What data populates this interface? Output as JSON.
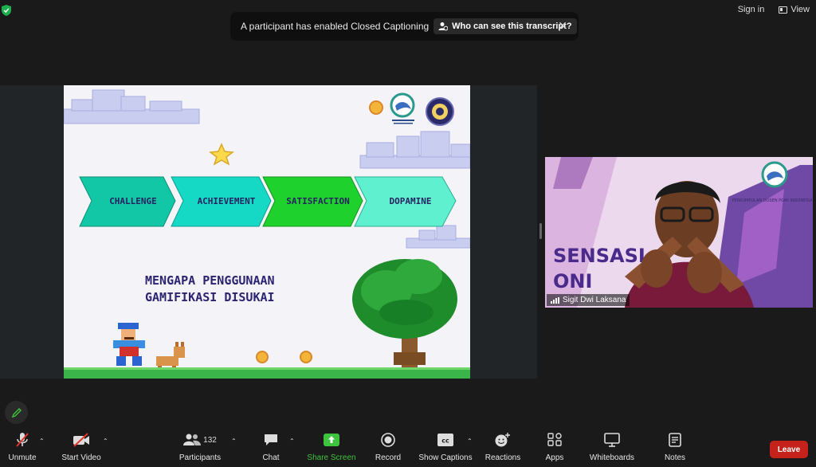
{
  "top": {
    "sign_in": "Sign in",
    "view": "View"
  },
  "notification": {
    "message": "A participant has enabled Closed Captioning",
    "button": "Who can see this transcript?"
  },
  "slide": {
    "steps": [
      "CHALLENGE",
      "ACHIEVEMENT",
      "SATISFACTION",
      "DOPAMINE"
    ],
    "title_line1": "MENGAPA PENGGUNAAN",
    "title_line2": "GAMIFIKASI DISUKAI",
    "colors": {
      "step1": "#12c7a6",
      "step2": "#16d9c5",
      "step3": "#1fd12c",
      "step4": "#5ff0d0",
      "title": "#2b2470"
    }
  },
  "video": {
    "speaker_name": "Sigit Dwi Laksana",
    "banner_text": "SENSASI",
    "banner_text2": "ONI",
    "org_text": "PERKUMPULAN DOSEN PGMI INDONESIA"
  },
  "toolbar": {
    "unmute": "Unmute",
    "start_video": "Start Video",
    "participants": "Participants",
    "participants_count": "132",
    "chat": "Chat",
    "share_screen": "Share Screen",
    "record": "Record",
    "show_captions": "Show Captions",
    "reactions": "Reactions",
    "apps": "Apps",
    "whiteboards": "Whiteboards",
    "notes": "Notes",
    "leave": "Leave"
  },
  "colors": {
    "share_green": "#3ec33e",
    "leave_red": "#c4221b"
  }
}
